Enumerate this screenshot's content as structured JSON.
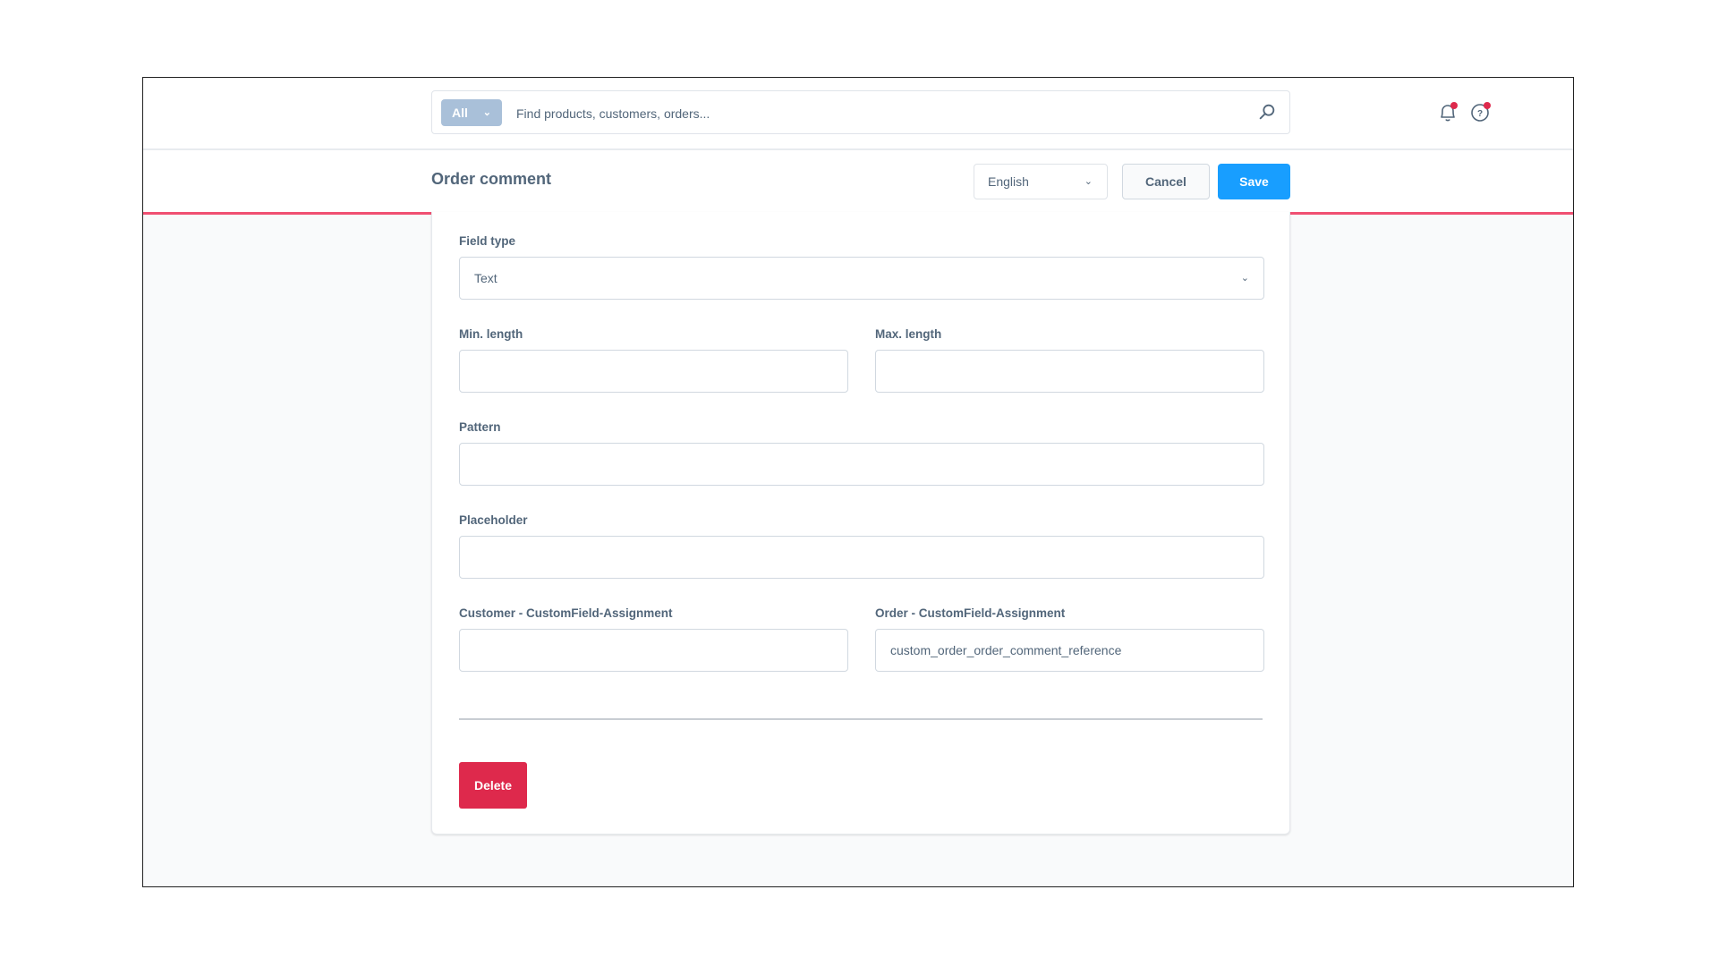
{
  "topbar": {
    "search_type": "All",
    "search_placeholder": "Find products, customers, orders...",
    "search_value": ""
  },
  "smartbar": {
    "title": "Order comment",
    "language": "English",
    "cancel_label": "Cancel",
    "save_label": "Save"
  },
  "form": {
    "field_type": {
      "label": "Field type",
      "value": "Text"
    },
    "min_length": {
      "label": "Min. length",
      "value": ""
    },
    "max_length": {
      "label": "Max. length",
      "value": ""
    },
    "pattern": {
      "label": "Pattern",
      "value": ""
    },
    "placeholder": {
      "label": "Placeholder",
      "value": ""
    },
    "customer_assignment": {
      "label": "Customer - CustomField-Assignment",
      "value": ""
    },
    "order_assignment": {
      "label": "Order - CustomField-Assignment",
      "value": "custom_order_order_comment_reference"
    },
    "delete_label": "Delete"
  },
  "colors": {
    "primary": "#189eff",
    "danger": "#de294c",
    "accent_line": "#f05072"
  }
}
